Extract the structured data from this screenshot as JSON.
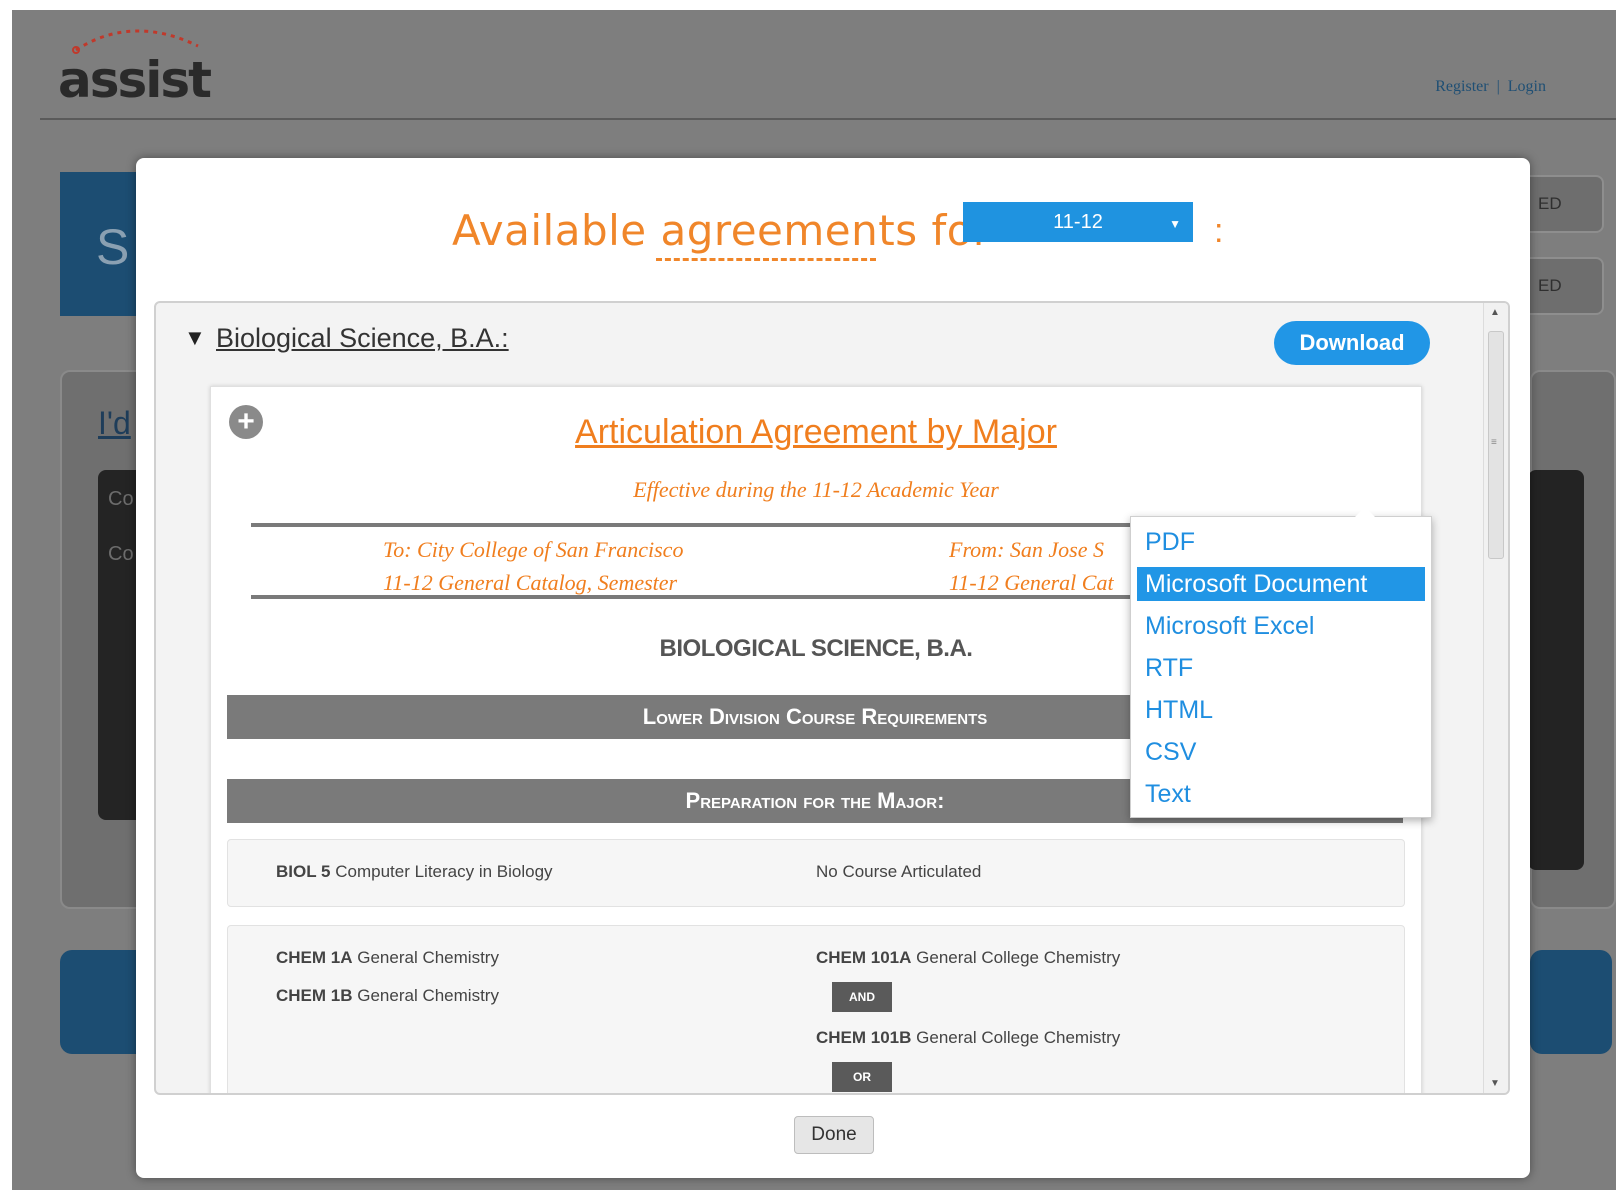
{
  "header": {
    "logo_text": "assist",
    "register_label": "Register",
    "link_separator": "|",
    "login_label": "Login"
  },
  "background": {
    "left_heading_fragment": "S",
    "left_link_fragment": "I'd",
    "left_row1_fragment": "Co",
    "left_row2_fragment": "Co",
    "right_btn1_fragment": "ED",
    "right_btn2_fragment": "ED"
  },
  "modal": {
    "title": "Available agreements for",
    "year_selected": "11-12",
    "title_suffix": ":",
    "done_label": "Done"
  },
  "agreement_item": {
    "title": "Biological Science, B.A.:",
    "download_label": "Download"
  },
  "download_menu": {
    "items": [
      {
        "label": "PDF"
      },
      {
        "label": "Microsoft Document"
      },
      {
        "label": "Microsoft Excel"
      },
      {
        "label": "RTF"
      },
      {
        "label": "HTML"
      },
      {
        "label": "CSV"
      },
      {
        "label": "Text"
      }
    ],
    "highlighted": "Microsoft Document"
  },
  "document": {
    "title": "Articulation Agreement by Major",
    "subtitle": "Effective during the 11-12 Academic Year",
    "to_line1": "To: City College of San Francisco",
    "to_line2": "11-12 General Catalog, Semester",
    "from_line1": "From: San Jose S",
    "from_line2": "11-12 General Cat",
    "major_heading": "BIOLOGICAL SCIENCE, B.A.",
    "section1": "Lower Division Course Requirements",
    "section2": "Preparation for the Major:",
    "rows": [
      {
        "left_code": "BIOL 5",
        "left_title": "Computer Literacy in Biology",
        "right_text": "No Course Articulated"
      },
      {
        "left1_code": "CHEM 1A",
        "left1_title": "General Chemistry",
        "left2_code": "CHEM 1B",
        "left2_title": "General Chemistry",
        "right1_code": "CHEM 101A",
        "right1_title": "General College Chemistry",
        "conj1": "AND",
        "right2_code": "CHEM 101B",
        "right2_title": "General College Chemistry",
        "conj2": "OR"
      }
    ]
  }
}
